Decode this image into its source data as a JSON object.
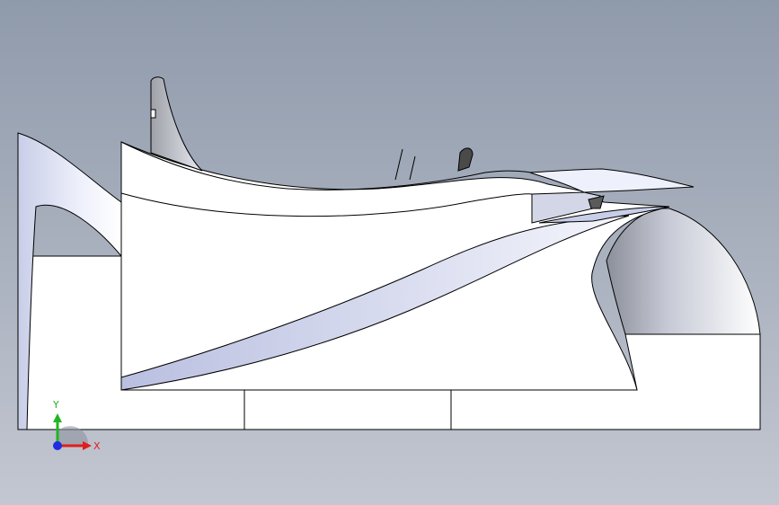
{
  "viewport": {
    "background_top": "#8f9aab",
    "background_bottom": "#c3c7d1",
    "model_fill": "#ffffff",
    "model_shade": "#c9cee8",
    "model_outline": "#000000",
    "dark_part": "#4a4a4a"
  },
  "triad": {
    "x_label": "X",
    "y_label": "Y",
    "x_color": "#e01e1e",
    "y_color": "#22b522",
    "z_color": "#1e2ee0"
  }
}
